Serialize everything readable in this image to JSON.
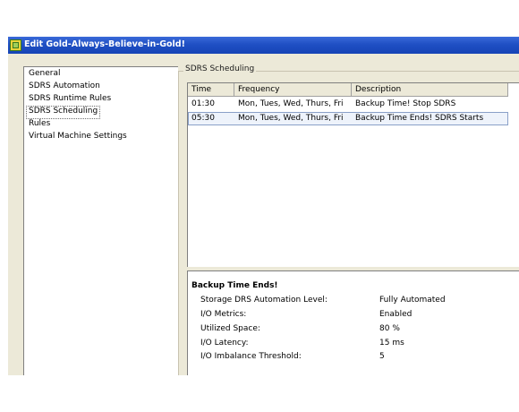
{
  "window": {
    "title": "Edit Gold-Always-Believe-in-Gold!"
  },
  "nav": {
    "items": [
      {
        "label": "General"
      },
      {
        "label": "SDRS Automation"
      },
      {
        "label": "SDRS Runtime Rules"
      },
      {
        "label": "SDRS Scheduling",
        "selected": true
      },
      {
        "label": "Rules"
      },
      {
        "label": "Virtual Machine Settings"
      }
    ]
  },
  "scheduling": {
    "group_label": "SDRS Scheduling",
    "columns": [
      "Time",
      "Frequency",
      "Description"
    ],
    "rows": [
      {
        "time": "01:30",
        "frequency": "Mon, Tues, Wed, Thurs, Fri",
        "description": "Backup Time! Stop SDRS"
      },
      {
        "time": "05:30",
        "frequency": "Mon, Tues, Wed, Thurs, Fri",
        "description": "Backup Time Ends! SDRS Starts",
        "selected": true
      }
    ]
  },
  "details": {
    "title": "Backup Time Ends!",
    "rows": [
      {
        "label": "Storage DRS Automation Level:",
        "value": "Fully Automated"
      },
      {
        "label": "I/O Metrics:",
        "value": "Enabled"
      },
      {
        "label": "Utilized Space:",
        "value": "80 %"
      },
      {
        "label": "I/O Latency:",
        "value": "15 ms"
      },
      {
        "label": "I/O Imbalance Threshold:",
        "value": "5"
      }
    ]
  },
  "colors": {
    "titlebar": "#1f4fc4",
    "window_bg": "#ece9d8",
    "selection_border": "#8aa0c8"
  },
  "icons": {
    "app": "app-icon"
  }
}
